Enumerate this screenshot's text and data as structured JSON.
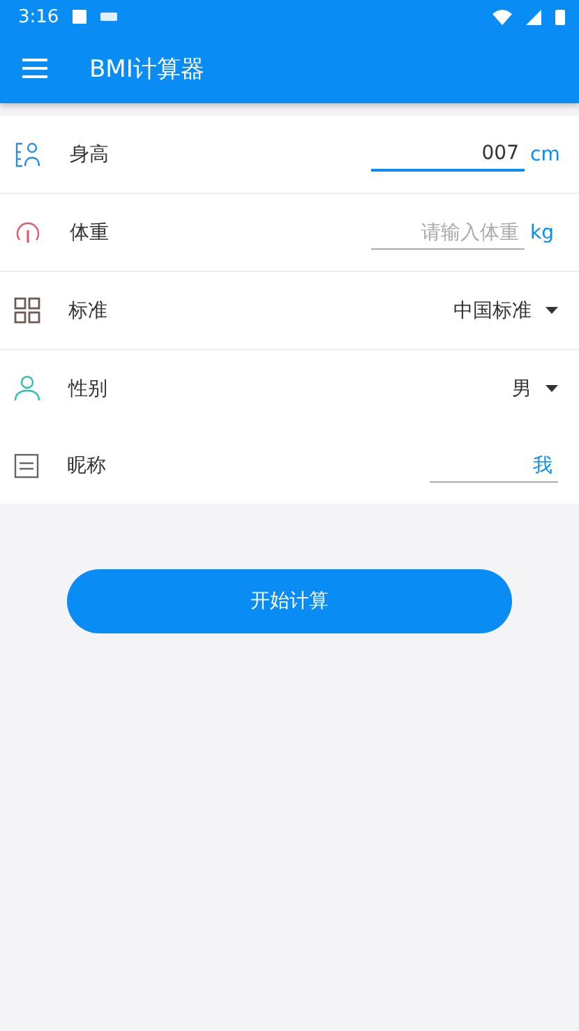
{
  "status_bar": {
    "time": "3:16"
  },
  "app_bar": {
    "title": "BMI计算器"
  },
  "rows": [
    {
      "kind": "input",
      "label": "身高",
      "value": "007",
      "focused": true,
      "unit": "cm"
    },
    {
      "kind": "input",
      "label": "体重",
      "placeholder": "请输入体重",
      "focused": false,
      "unit": "kg"
    },
    {
      "kind": "select",
      "label": "标准",
      "value": "中国标准"
    },
    {
      "kind": "select",
      "label": "性别",
      "value": "男"
    },
    {
      "kind": "input",
      "label": "昵称",
      "value": "我",
      "focused": false
    }
  ],
  "button": {
    "label": "开始计算"
  }
}
